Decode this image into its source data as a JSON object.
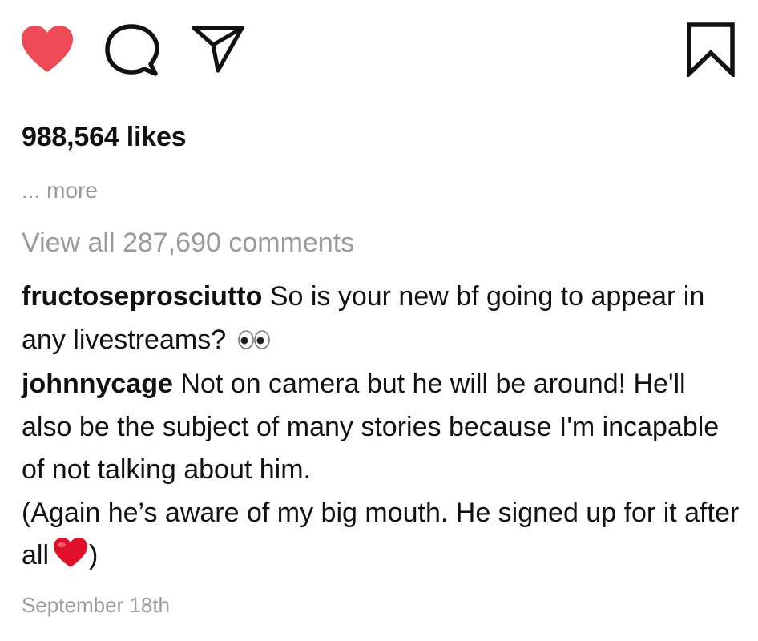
{
  "actions": {
    "like_icon": "heart-filled",
    "like_color": "#ed4956",
    "comment_icon": "speech-bubble",
    "share_icon": "paper-plane",
    "save_icon": "bookmark"
  },
  "post": {
    "likes_text": "988,564 likes",
    "caption_more": "... more",
    "view_all_comments": "View all 287,690 comments",
    "timestamp": "September 18th"
  },
  "comments": [
    {
      "username": "fructoseprosciutto",
      "text": "So is your new bf going to appear in any livestreams?",
      "emoji": "eyes"
    },
    {
      "username": "johnnycage",
      "text_line1": "Not on camera but he will be around! He'll also be the subject of many stories because I'm incapable of not talking about him.",
      "text_line2": "(Again he’s aware of my big mouth. He signed up for it after all",
      "text_end": ")",
      "emoji": "red-heart"
    }
  ]
}
